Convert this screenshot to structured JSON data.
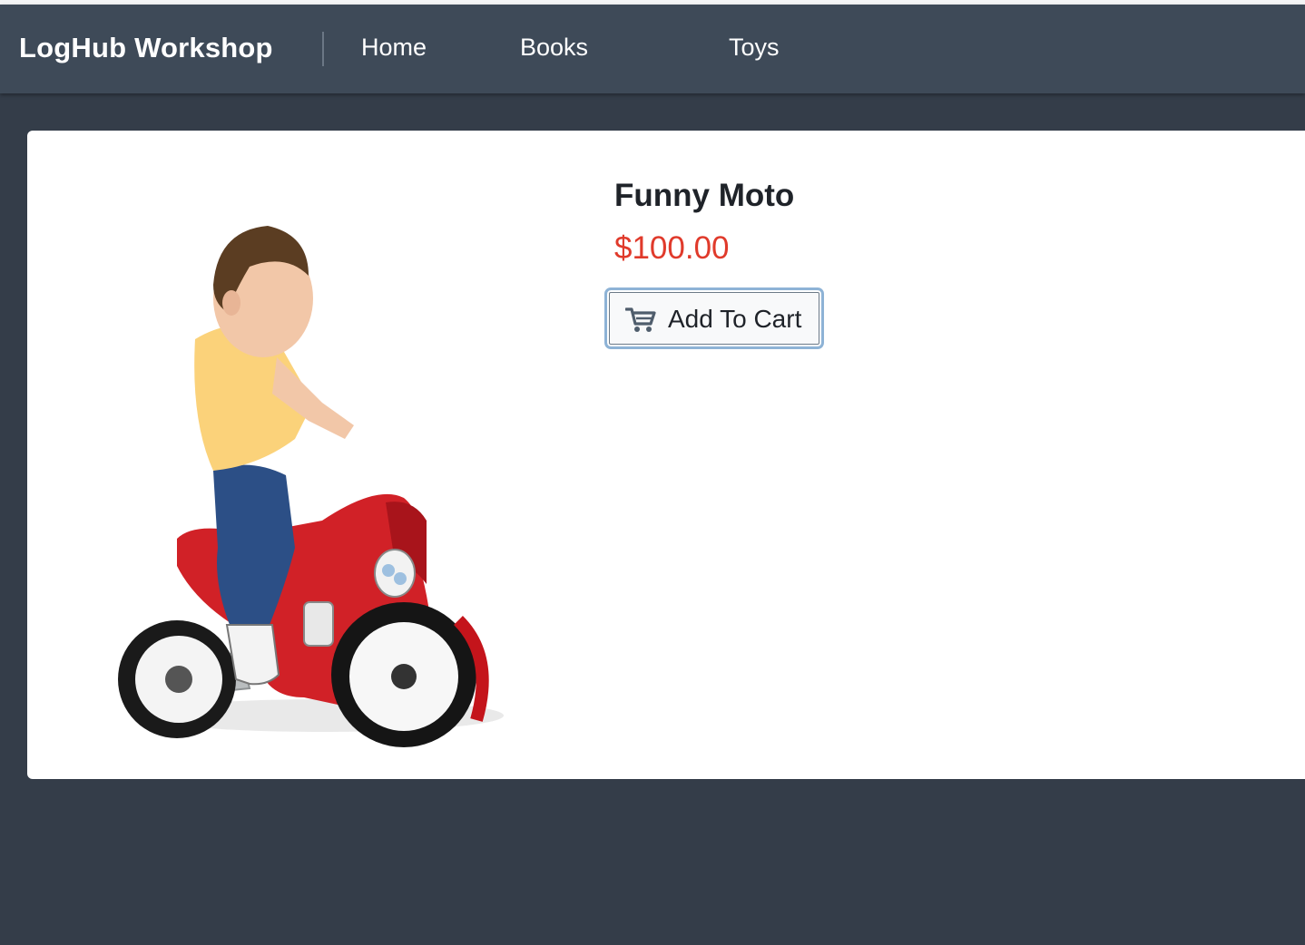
{
  "navbar": {
    "brand": "LogHub Workshop",
    "links": [
      {
        "label": "Home"
      },
      {
        "label": "Books"
      },
      {
        "label": "Toys"
      }
    ]
  },
  "product": {
    "name": "Funny Moto",
    "price": "$100.00",
    "add_to_cart_label": "Add To Cart",
    "add_to_cart_icon": "cart-icon",
    "image_subject": "child-on-red-ride-on-motorcycle"
  },
  "colors": {
    "navbar_bg": "#3e4a58",
    "page_bg": "#343d49",
    "price": "#e03a2b",
    "button_focus_ring": "#8eb3d6"
  }
}
